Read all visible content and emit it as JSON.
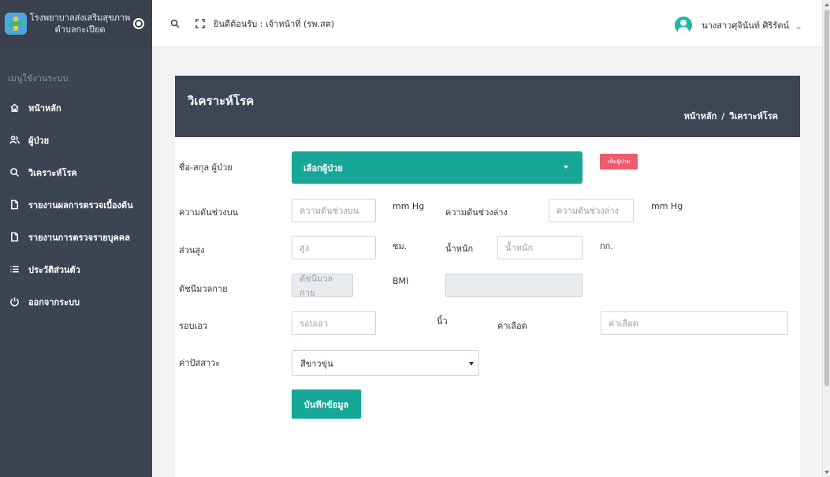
{
  "brand": {
    "line1": "โรงพยาบาลส่งเสริมสุขภาพ",
    "line2": "ตำบลกะเปียด"
  },
  "sidebar": {
    "header": "เมนูใช้งานระบบ",
    "items": [
      {
        "label": "หน้าหลัก",
        "icon": "home-icon"
      },
      {
        "label": "ผู้ป่วย",
        "icon": "users-icon"
      },
      {
        "label": "วิเคราะห์โรค",
        "icon": "search-icon"
      },
      {
        "label": "รายงานผลการตรวจเบื้องต้น",
        "icon": "file-icon"
      },
      {
        "label": "รายงานการตรวจรายบุคคล",
        "icon": "file-icon"
      },
      {
        "label": "ประวัติส่วนตัว",
        "icon": "list-icon"
      },
      {
        "label": "ออกจากระบบ",
        "icon": "power-icon"
      }
    ]
  },
  "topbar": {
    "welcome": "ยินดีต้อนรับ : เจ้าหน้าที่ (รพ.สต)",
    "user_name": "นางสาวศุจินันท์ ศิริรัตน์"
  },
  "page": {
    "title": "วิเคราะห์โรค",
    "breadcrumb": [
      "หน้าหลัก",
      "วิเคราะห์โรค"
    ]
  },
  "form": {
    "patient_label": "ชื่อ-สกุล ผู้ป่วย",
    "patient_select": "เลือกผู้ป่วย",
    "add_patient": "เพิ่มผู้ป่วย",
    "sys_label": "ความดันช่วงบน",
    "sys_placeholder": "ความดันช่วงบน",
    "sys_unit": "mm Hg",
    "dia_label": "ความดันช่วงล่าง",
    "dia_placeholder": "ความดันช่วงล่าง",
    "dia_unit": "mm Hg",
    "height_label": "ส่วนสูง",
    "height_placeholder": "สูง",
    "height_unit": "ซม.",
    "weight_label": "น้ำหนัก",
    "weight_placeholder": "น้ำหนัก",
    "weight_unit": "กก.",
    "bmi_label": "ดัชนีมวลกาย",
    "bmi_placeholder": "ดัชนีมวลกาย",
    "bmi_unit": "BMI",
    "waist_label": "รอบเอว",
    "waist_placeholder": "รอบเอว",
    "waist_unit": "นิ้ว",
    "blood_label": "ค่าเลือด",
    "blood_placeholder": "ค่าเลือด",
    "urine_label": "ค่าปัสสาวะ",
    "urine_value": "สีขาวขุ่น",
    "save": "บันทึกข้อมูล"
  }
}
